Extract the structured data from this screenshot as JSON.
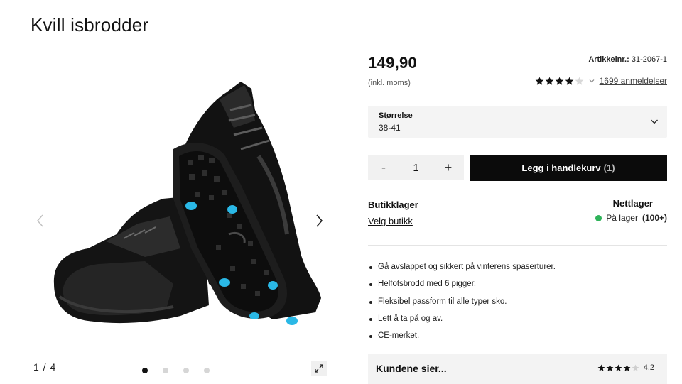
{
  "product": {
    "title": "Kvill isbrodder",
    "price": "149,90",
    "vat_note": "(inkl. moms)",
    "article_label": "Artikkelnr.:",
    "article_number": "31-2067-1",
    "rating": 4.2,
    "reviews_link": "1699 anmeldelser"
  },
  "gallery": {
    "counter": "1  /  4",
    "slides": 4,
    "active_slide": 1
  },
  "size": {
    "label": "Størrelse",
    "value": "38-41"
  },
  "quantity": {
    "minus": "-",
    "value": "1",
    "plus": "+"
  },
  "cart": {
    "label": "Legg i handlekurv",
    "count": "(1)"
  },
  "store": {
    "heading": "Butikklager",
    "link": "Velg butikk"
  },
  "online": {
    "heading": "Nettlager",
    "status": "På lager",
    "count": "(100+)"
  },
  "features": [
    "Gå avslappet og sikkert på vinterens spaserturer.",
    "Helfotsbrodd med 6 pigger.",
    "Fleksibel passform til alle typer sko.",
    "Lett å ta på og av.",
    "CE-merket."
  ],
  "customers": {
    "heading": "Kundene sier...",
    "score": "4.2"
  },
  "colors": {
    "accent_black": "#0b0b0b",
    "stock_green": "#2fb35a",
    "panel_grey": "#f4f4f4",
    "spike_blue": "#2ab8e6"
  }
}
